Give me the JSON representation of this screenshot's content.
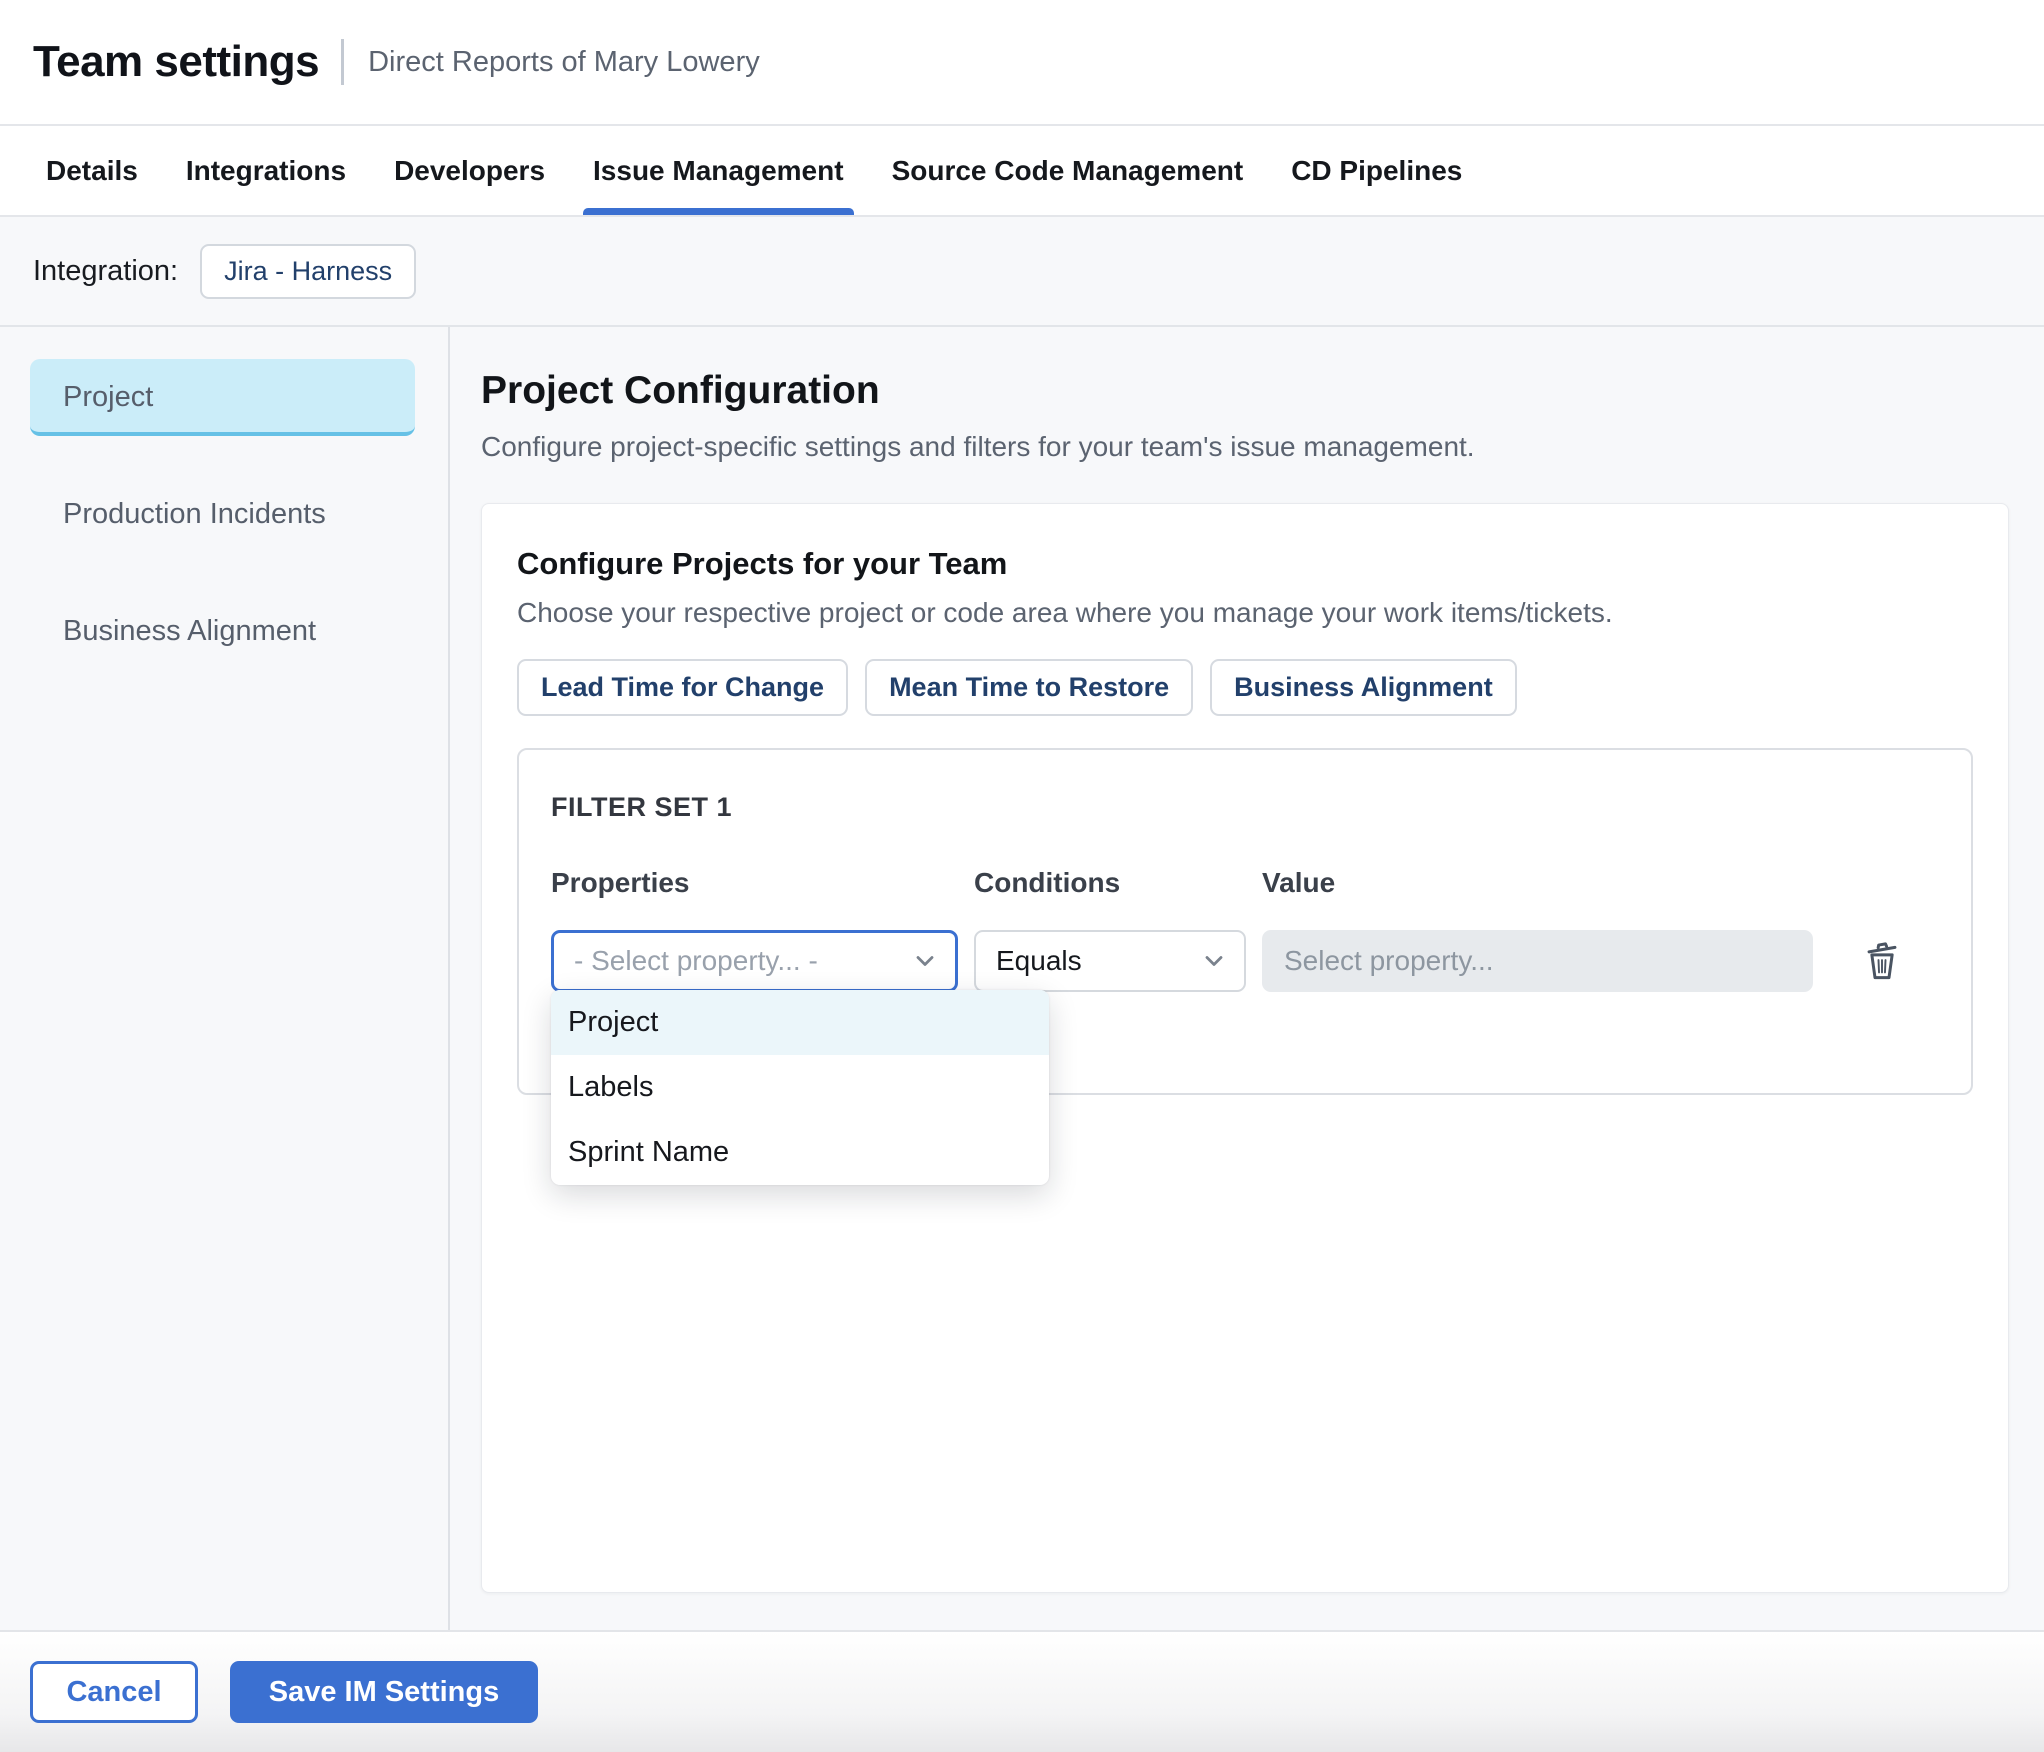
{
  "header": {
    "title": "Team settings",
    "subtitle": "Direct Reports of Mary Lowery"
  },
  "tabs": [
    {
      "label": "Details"
    },
    {
      "label": "Integrations"
    },
    {
      "label": "Developers"
    },
    {
      "label": "Issue Management",
      "active": true
    },
    {
      "label": "Source Code Management"
    },
    {
      "label": "CD Pipelines"
    }
  ],
  "integration": {
    "label": "Integration:",
    "value": "Jira - Harness"
  },
  "sidebar": {
    "items": [
      {
        "label": "Project",
        "active": true
      },
      {
        "label": "Production Incidents"
      },
      {
        "label": "Business Alignment"
      }
    ]
  },
  "main": {
    "title": "Project Configuration",
    "description": "Configure project-specific settings and filters for your team's issue management.",
    "card": {
      "title": "Configure Projects for your Team",
      "description": "Choose your respective project or code area where you manage your work items/tickets.",
      "chips": [
        {
          "label": "Lead Time for Change"
        },
        {
          "label": "Mean Time to Restore"
        },
        {
          "label": "Business Alignment"
        }
      ],
      "filter_set": {
        "title": "FILTER SET 1",
        "columns": {
          "properties": "Properties",
          "conditions": "Conditions",
          "value": "Value"
        },
        "properties_placeholder": "- Select property... -",
        "condition_value": "Equals",
        "value_placeholder": "Select property...",
        "dropdown": {
          "options": [
            {
              "label": "Project",
              "highlighted": true
            },
            {
              "label": "Labels"
            },
            {
              "label": "Sprint Name"
            }
          ]
        }
      }
    }
  },
  "footer": {
    "cancel_label": "Cancel",
    "save_label": "Save IM Settings"
  },
  "colors": {
    "accent_blue": "#3B70D1",
    "sidebar_active_bg": "#CBEDF9",
    "sidebar_active_border": "#66C1E6",
    "dropdown_highlight": "#EBF6FA",
    "chip_text": "#22406B",
    "value_field_bg": "#E7EAED"
  }
}
